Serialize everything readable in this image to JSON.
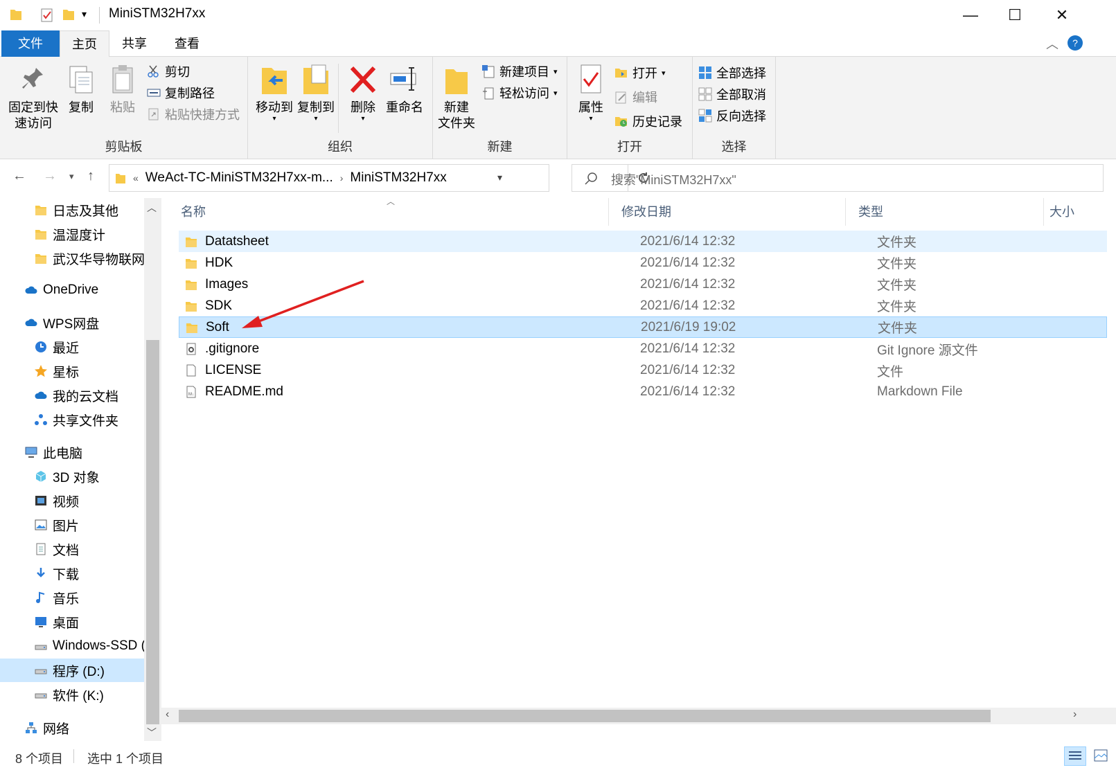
{
  "window": {
    "title": "MiniSTM32H7xx",
    "minimize": "—",
    "maximize": "☐",
    "close": "✕"
  },
  "tabs": {
    "file": "文件",
    "home": "主页",
    "share": "共享",
    "view": "查看"
  },
  "ribbon": {
    "clipboard": {
      "label": "剪贴板",
      "pin": "固定到快\n速访问",
      "pin_line1": "固定到快",
      "pin_line2": "速访问",
      "copy": "复制",
      "paste": "粘贴",
      "cut": "剪切",
      "copy_path": "复制路径",
      "paste_shortcut": "粘贴快捷方式"
    },
    "organize": {
      "label": "组织",
      "move_to": "移动到",
      "copy_to": "复制到",
      "delete": "删除",
      "rename": "重命名"
    },
    "new": {
      "label": "新建",
      "new_folder_line1": "新建",
      "new_folder_line2": "文件夹",
      "new_item": "新建项目",
      "easy_access": "轻松访问"
    },
    "open": {
      "label": "打开",
      "properties": "属性",
      "open": "打开",
      "edit": "编辑",
      "history": "历史记录"
    },
    "select": {
      "label": "选择",
      "select_all": "全部选择",
      "select_none": "全部取消",
      "invert": "反向选择"
    }
  },
  "address": {
    "crumb1": "WeAct-TC-MiniSTM32H7xx-m...",
    "crumb2": "MiniSTM32H7xx",
    "search_placeholder": "搜索\"MiniSTM32H7xx\""
  },
  "nav": [
    {
      "label": "日志及其他",
      "icon": "folder-icon"
    },
    {
      "label": "温湿度计",
      "icon": "folder-icon"
    },
    {
      "label": "武汉华导物联网",
      "icon": "folder-icon"
    },
    {
      "label": "OneDrive",
      "icon": "cloud-icon"
    },
    {
      "label": "WPS网盘",
      "icon": "cloud-icon"
    },
    {
      "label": "最近",
      "icon": "clock-icon"
    },
    {
      "label": "星标",
      "icon": "star-icon"
    },
    {
      "label": "我的云文档",
      "icon": "cloud-icon"
    },
    {
      "label": "共享文件夹",
      "icon": "share-icon"
    },
    {
      "label": "此电脑",
      "icon": "computer-icon"
    },
    {
      "label": "3D 对象",
      "icon": "cube-icon"
    },
    {
      "label": "视频",
      "icon": "video-icon"
    },
    {
      "label": "图片",
      "icon": "picture-icon"
    },
    {
      "label": "文档",
      "icon": "document-icon"
    },
    {
      "label": "下载",
      "icon": "download-icon"
    },
    {
      "label": "音乐",
      "icon": "music-icon"
    },
    {
      "label": "桌面",
      "icon": "desktop-icon"
    },
    {
      "label": "Windows-SSD (",
      "icon": "drive-icon"
    },
    {
      "label": "程序 (D:)",
      "icon": "drive-icon"
    },
    {
      "label": "软件 (K:)",
      "icon": "drive-icon"
    },
    {
      "label": "网络",
      "icon": "network-icon"
    }
  ],
  "columns": {
    "name": "名称",
    "date": "修改日期",
    "type": "类型",
    "size": "大小"
  },
  "files": [
    {
      "name": "Datatsheet",
      "date": "2021/6/14 12:32",
      "type": "文件夹",
      "icon": "folder-icon"
    },
    {
      "name": "HDK",
      "date": "2021/6/14 12:32",
      "type": "文件夹",
      "icon": "folder-icon"
    },
    {
      "name": "Images",
      "date": "2021/6/14 12:32",
      "type": "文件夹",
      "icon": "folder-icon"
    },
    {
      "name": "SDK",
      "date": "2021/6/14 12:32",
      "type": "文件夹",
      "icon": "folder-icon"
    },
    {
      "name": "Soft",
      "date": "2021/6/19 19:02",
      "type": "文件夹",
      "icon": "folder-icon"
    },
    {
      "name": ".gitignore",
      "date": "2021/6/14 12:32",
      "type": "Git Ignore 源文件",
      "icon": "settings-file-icon"
    },
    {
      "name": "LICENSE",
      "date": "2021/6/14 12:32",
      "type": "文件",
      "icon": "file-icon"
    },
    {
      "name": "README.md",
      "date": "2021/6/14 12:32",
      "type": "Markdown File",
      "icon": "markdown-file-icon"
    }
  ],
  "status": {
    "count": "8 个项目",
    "selected": "选中 1 个项目"
  },
  "colors": {
    "accent": "#1a73c8",
    "selection": "#cce8ff",
    "annotation": "#e02020",
    "folder": "#f7c948"
  }
}
